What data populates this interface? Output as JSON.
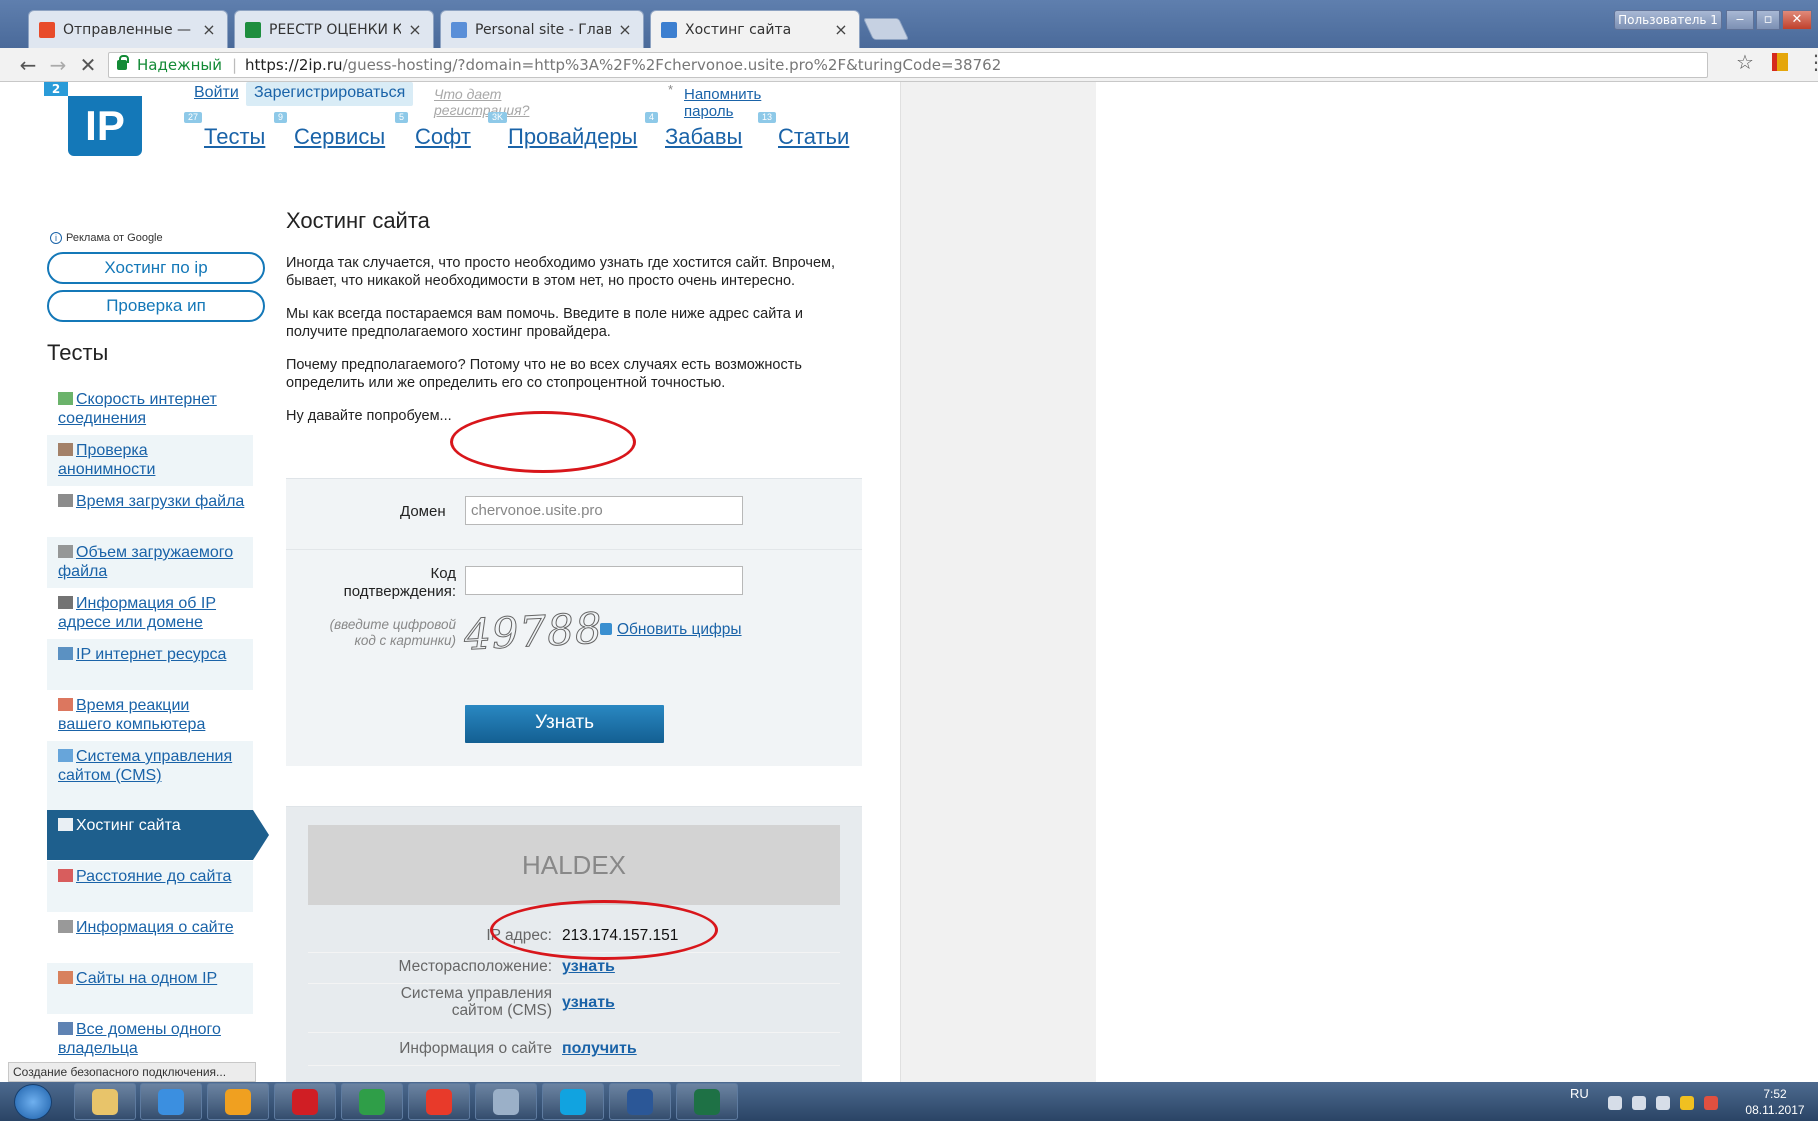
{
  "browser": {
    "tabs": [
      {
        "label": "Отправленные — Янде",
        "icon_color": "#e84b2a",
        "icon": "yandex-mail-icon"
      },
      {
        "label": "РЕЕСТР ОЦЕНКИ КАЧЕС",
        "icon_color": "#1e8e3e",
        "icon": "sheets-icon"
      },
      {
        "label": "Personal site - Главная с",
        "icon_color": "#5a8fd8",
        "icon": "site-icon"
      },
      {
        "label": "Хостинг сайта",
        "icon_color": "#3c7fd0",
        "icon": "loading-icon"
      }
    ],
    "user_label": "Пользователь 1",
    "secure_label": "Надежный",
    "url_host": "https://2ip.ru",
    "url_rest": "/guess-hosting/?domain=http%3A%2F%2Fchervonoe.usite.pro%2F&turingCode=38762",
    "status_text": "Создание безопасного подключения..."
  },
  "site": {
    "logo_text": "IP",
    "logo_badge": "2",
    "auth": {
      "login": "Войти",
      "register": "Зарегистрироваться",
      "why": "Что дает регистрация?",
      "asterisk": "*",
      "remind": "Напомнить пароль"
    },
    "nav": [
      {
        "label": "Тесты",
        "badge": "27"
      },
      {
        "label": "Сервисы",
        "badge": "9"
      },
      {
        "label": "Софт",
        "badge": "5"
      },
      {
        "label": "Провайдеры",
        "badge": "3K"
      },
      {
        "label": "Забавы",
        "badge": "4"
      },
      {
        "label": "Статьи",
        "badge": "13"
      }
    ],
    "sidebar": {
      "ad_label": "Реклама от Google",
      "ad_buttons": [
        "Хостинг по ip",
        "Проверка ип"
      ],
      "title": "Тесты",
      "items": [
        {
          "label": "Скорость интернет соединения",
          "icon": "speed-icon",
          "icon_color": "#3a9a3a"
        },
        {
          "label": "Проверка анонимности",
          "icon": "anonymity-icon",
          "icon_color": "#8a5a3a"
        },
        {
          "label": "Время загрузки файла",
          "icon": "clock-icon",
          "icon_color": "#666666"
        },
        {
          "label": "Объем загружаемого файла",
          "icon": "file-size-icon",
          "icon_color": "#777777"
        },
        {
          "label": "Информация об IP адресе или домене",
          "icon": "ip-info-icon",
          "icon_color": "#444444"
        },
        {
          "label": "IP интернет ресурса",
          "icon": "ip-resource-icon",
          "icon_color": "#2a6fb0"
        },
        {
          "label": "Время реакции вашего компьютера",
          "icon": "reaction-icon",
          "icon_color": "#d04a2a"
        },
        {
          "label": "Система управления сайтом (CMS)",
          "icon": "cms-icon",
          "icon_color": "#3a8ad0"
        },
        {
          "label": "Хостинг сайта",
          "icon": "hosting-icon",
          "icon_color": "#ffffff",
          "active": true
        },
        {
          "label": "Расстояние до сайта",
          "icon": "map-pin-icon",
          "icon_color": "#d02a2a"
        },
        {
          "label": "Информация о сайте",
          "icon": "site-info-icon",
          "icon_color": "#777777"
        },
        {
          "label": "Сайты на одном IP",
          "icon": "same-ip-icon",
          "icon_color": "#d05a2a"
        },
        {
          "label": "Все домены одного владельца",
          "icon": "domains-icon",
          "icon_color": "#2a5a9a"
        }
      ]
    },
    "content": {
      "title": "Хостинг сайта",
      "paragraphs": [
        "Иногда так случается, что просто необходимо узнать где хостится сайт. Впрочем, бывает, что никакой необходимости в этом нет, но просто очень интересно.",
        "Мы как всегда постараемся вам помочь. Введите в поле ниже адрес сайта и получите предполагаемого хостинг провайдера.",
        "Почему предполагаемого? Потому что не во всех случаях есть возможность определить или же определить его со стопроцентной точностью.",
        "Ну давайте попробуем..."
      ]
    },
    "form": {
      "domain_label": "Домен",
      "domain_value": "chervonoe.usite.pro",
      "code_label": "Код подтверждения:",
      "code_value": "",
      "code_hint": "(введите цифровой код с картинки)",
      "captcha_text": "49788",
      "refresh_label": "Обновить цифры",
      "submit_label": "Узнать"
    },
    "result": {
      "provider": "HALDEX",
      "rows": [
        {
          "label": "IP адрес:",
          "value": "213.174.157.151",
          "is_link": false
        },
        {
          "label": "Месторасположение:",
          "value": "узнать",
          "is_link": true
        },
        {
          "label": "Система управления сайтом (CMS)",
          "value": "узнать",
          "is_link": true
        },
        {
          "label": "Информация о сайте",
          "value": "получить",
          "is_link": true
        }
      ]
    }
  },
  "taskbar": {
    "apps": [
      {
        "name": "explorer",
        "color": "#e8c46a"
      },
      {
        "name": "internet-explorer",
        "color": "#3b8fe0"
      },
      {
        "name": "avast",
        "color": "#f0a020"
      },
      {
        "name": "opera",
        "color": "#d01e24"
      },
      {
        "name": "chrome",
        "color": "#2f9e48"
      },
      {
        "name": "yandex-browser",
        "color": "#e83a2a"
      },
      {
        "name": "calculator",
        "color": "#9bb0c8"
      },
      {
        "name": "skype",
        "color": "#11a3e0"
      },
      {
        "name": "word",
        "color": "#2b5797"
      },
      {
        "name": "excel",
        "color": "#1e7145"
      }
    ],
    "language": "RU",
    "time": "7:52",
    "date": "08.11.2017"
  }
}
